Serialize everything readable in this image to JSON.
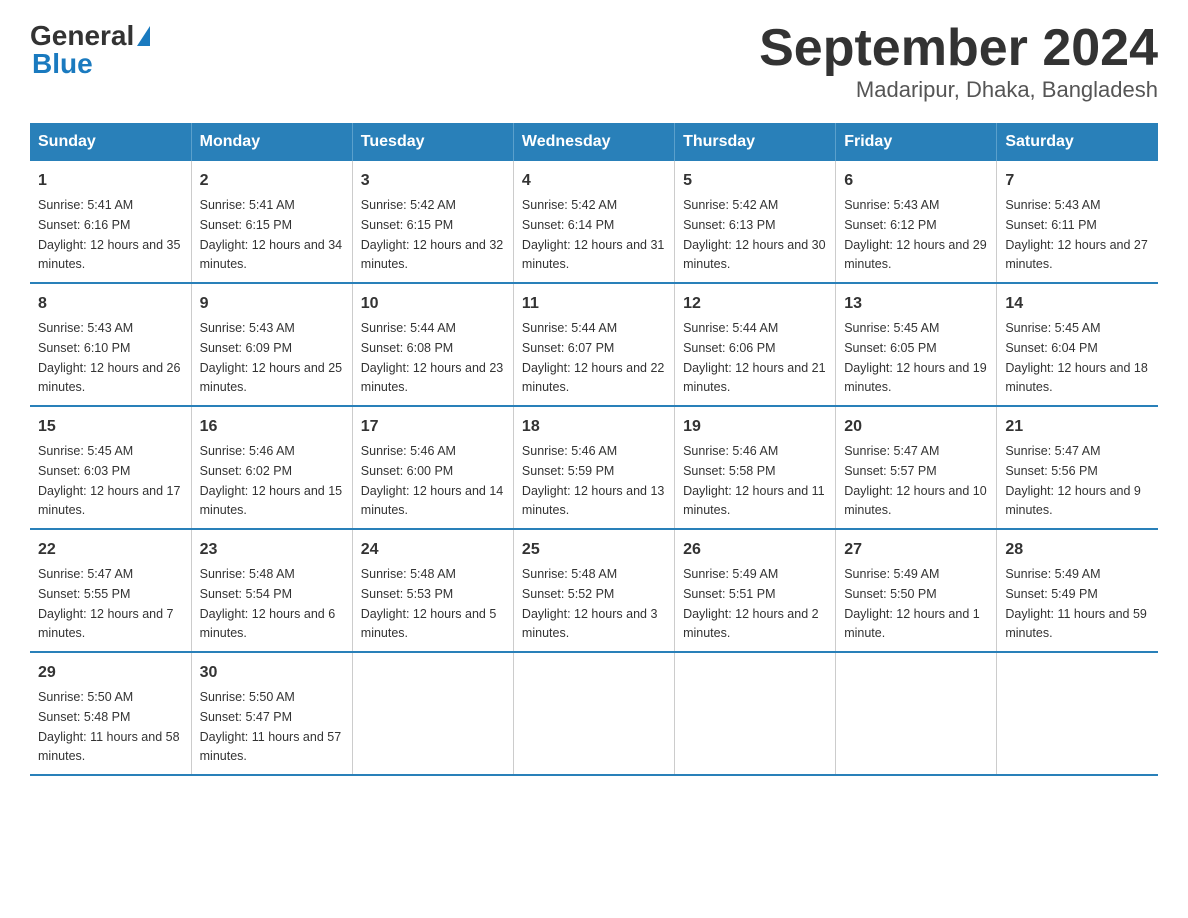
{
  "header": {
    "logo_general": "General",
    "logo_blue": "Blue",
    "title": "September 2024",
    "subtitle": "Madaripur, Dhaka, Bangladesh"
  },
  "columns": [
    "Sunday",
    "Monday",
    "Tuesday",
    "Wednesday",
    "Thursday",
    "Friday",
    "Saturday"
  ],
  "weeks": [
    [
      {
        "day": "1",
        "sunrise": "5:41 AM",
        "sunset": "6:16 PM",
        "daylight": "12 hours and 35 minutes."
      },
      {
        "day": "2",
        "sunrise": "5:41 AM",
        "sunset": "6:15 PM",
        "daylight": "12 hours and 34 minutes."
      },
      {
        "day": "3",
        "sunrise": "5:42 AM",
        "sunset": "6:15 PM",
        "daylight": "12 hours and 32 minutes."
      },
      {
        "day": "4",
        "sunrise": "5:42 AM",
        "sunset": "6:14 PM",
        "daylight": "12 hours and 31 minutes."
      },
      {
        "day": "5",
        "sunrise": "5:42 AM",
        "sunset": "6:13 PM",
        "daylight": "12 hours and 30 minutes."
      },
      {
        "day": "6",
        "sunrise": "5:43 AM",
        "sunset": "6:12 PM",
        "daylight": "12 hours and 29 minutes."
      },
      {
        "day": "7",
        "sunrise": "5:43 AM",
        "sunset": "6:11 PM",
        "daylight": "12 hours and 27 minutes."
      }
    ],
    [
      {
        "day": "8",
        "sunrise": "5:43 AM",
        "sunset": "6:10 PM",
        "daylight": "12 hours and 26 minutes."
      },
      {
        "day": "9",
        "sunrise": "5:43 AM",
        "sunset": "6:09 PM",
        "daylight": "12 hours and 25 minutes."
      },
      {
        "day": "10",
        "sunrise": "5:44 AM",
        "sunset": "6:08 PM",
        "daylight": "12 hours and 23 minutes."
      },
      {
        "day": "11",
        "sunrise": "5:44 AM",
        "sunset": "6:07 PM",
        "daylight": "12 hours and 22 minutes."
      },
      {
        "day": "12",
        "sunrise": "5:44 AM",
        "sunset": "6:06 PM",
        "daylight": "12 hours and 21 minutes."
      },
      {
        "day": "13",
        "sunrise": "5:45 AM",
        "sunset": "6:05 PM",
        "daylight": "12 hours and 19 minutes."
      },
      {
        "day": "14",
        "sunrise": "5:45 AM",
        "sunset": "6:04 PM",
        "daylight": "12 hours and 18 minutes."
      }
    ],
    [
      {
        "day": "15",
        "sunrise": "5:45 AM",
        "sunset": "6:03 PM",
        "daylight": "12 hours and 17 minutes."
      },
      {
        "day": "16",
        "sunrise": "5:46 AM",
        "sunset": "6:02 PM",
        "daylight": "12 hours and 15 minutes."
      },
      {
        "day": "17",
        "sunrise": "5:46 AM",
        "sunset": "6:00 PM",
        "daylight": "12 hours and 14 minutes."
      },
      {
        "day": "18",
        "sunrise": "5:46 AM",
        "sunset": "5:59 PM",
        "daylight": "12 hours and 13 minutes."
      },
      {
        "day": "19",
        "sunrise": "5:46 AM",
        "sunset": "5:58 PM",
        "daylight": "12 hours and 11 minutes."
      },
      {
        "day": "20",
        "sunrise": "5:47 AM",
        "sunset": "5:57 PM",
        "daylight": "12 hours and 10 minutes."
      },
      {
        "day": "21",
        "sunrise": "5:47 AM",
        "sunset": "5:56 PM",
        "daylight": "12 hours and 9 minutes."
      }
    ],
    [
      {
        "day": "22",
        "sunrise": "5:47 AM",
        "sunset": "5:55 PM",
        "daylight": "12 hours and 7 minutes."
      },
      {
        "day": "23",
        "sunrise": "5:48 AM",
        "sunset": "5:54 PM",
        "daylight": "12 hours and 6 minutes."
      },
      {
        "day": "24",
        "sunrise": "5:48 AM",
        "sunset": "5:53 PM",
        "daylight": "12 hours and 5 minutes."
      },
      {
        "day": "25",
        "sunrise": "5:48 AM",
        "sunset": "5:52 PM",
        "daylight": "12 hours and 3 minutes."
      },
      {
        "day": "26",
        "sunrise": "5:49 AM",
        "sunset": "5:51 PM",
        "daylight": "12 hours and 2 minutes."
      },
      {
        "day": "27",
        "sunrise": "5:49 AM",
        "sunset": "5:50 PM",
        "daylight": "12 hours and 1 minute."
      },
      {
        "day": "28",
        "sunrise": "5:49 AM",
        "sunset": "5:49 PM",
        "daylight": "11 hours and 59 minutes."
      }
    ],
    [
      {
        "day": "29",
        "sunrise": "5:50 AM",
        "sunset": "5:48 PM",
        "daylight": "11 hours and 58 minutes."
      },
      {
        "day": "30",
        "sunrise": "5:50 AM",
        "sunset": "5:47 PM",
        "daylight": "11 hours and 57 minutes."
      },
      null,
      null,
      null,
      null,
      null
    ]
  ],
  "labels": {
    "sunrise": "Sunrise:",
    "sunset": "Sunset:",
    "daylight": "Daylight:"
  }
}
